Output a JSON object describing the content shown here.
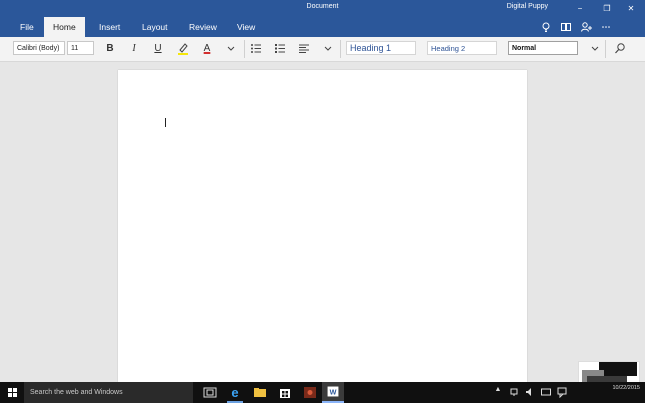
{
  "window": {
    "title": "Document",
    "user": "Digital Puppy",
    "controls": {
      "minimize": "−",
      "maximize": "❐",
      "close": "✕"
    }
  },
  "ribbon": {
    "tabs": [
      {
        "label": "File"
      },
      {
        "label": "Home"
      },
      {
        "label": "Insert"
      },
      {
        "label": "Layout"
      },
      {
        "label": "Review"
      },
      {
        "label": "View"
      }
    ],
    "active_tab": "Home",
    "right_icons": [
      "lightbulb-icon",
      "reading-view-icon",
      "share-icon",
      "more-icon"
    ]
  },
  "toolbar": {
    "font_name": "Calibri (Body)",
    "font_size": "11",
    "bold": "B",
    "italic": "I",
    "underline": "U",
    "font_color": "A",
    "styles": {
      "heading1": "Heading 1",
      "heading2": "Heading 2",
      "normal": "Normal"
    }
  },
  "taskbar": {
    "search_placeholder": "Search the web and Windows",
    "clock_time": "",
    "clock_date": "10/22/2015"
  },
  "colors": {
    "accent": "#2b579a",
    "heading_text": "#2f5496"
  }
}
